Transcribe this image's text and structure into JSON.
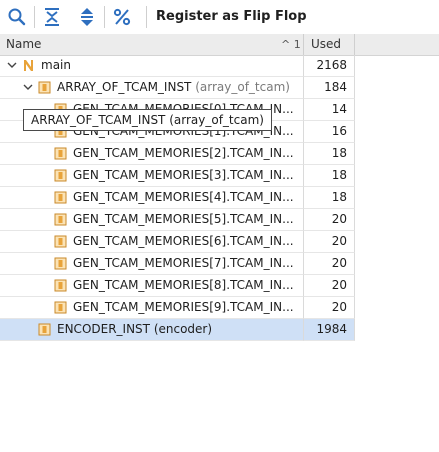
{
  "toolbar": {
    "title": "Register as Flip Flop",
    "buttons": [
      {
        "icon": "search-icon"
      },
      {
        "icon": "collapse-all-icon"
      },
      {
        "icon": "expand-all-icon"
      },
      {
        "icon": "percent-icon"
      }
    ]
  },
  "table": {
    "columns": {
      "name": "Name",
      "used": "Used",
      "sort_indicator": "^ 1"
    },
    "rows": [
      {
        "label": "main",
        "sub": "",
        "used": "2168"
      },
      {
        "label": "ARRAY_OF_TCAM_INST",
        "sub": "(array_of_tcam)",
        "used": "184"
      },
      {
        "label": "GEN_TCAM_MEMORIES[0].TCAM_IN...",
        "sub": "",
        "used": "14"
      },
      {
        "label": "GEN_TCAM_MEMORIES[1].TCAM_IN...",
        "sub": "",
        "used": "16"
      },
      {
        "label": "GEN_TCAM_MEMORIES[2].TCAM_IN...",
        "sub": "",
        "used": "18"
      },
      {
        "label": "GEN_TCAM_MEMORIES[3].TCAM_IN...",
        "sub": "",
        "used": "18"
      },
      {
        "label": "GEN_TCAM_MEMORIES[4].TCAM_IN...",
        "sub": "",
        "used": "18"
      },
      {
        "label": "GEN_TCAM_MEMORIES[5].TCAM_IN...",
        "sub": "",
        "used": "20"
      },
      {
        "label": "GEN_TCAM_MEMORIES[6].TCAM_IN...",
        "sub": "",
        "used": "20"
      },
      {
        "label": "GEN_TCAM_MEMORIES[7].TCAM_IN...",
        "sub": "",
        "used": "20"
      },
      {
        "label": "GEN_TCAM_MEMORIES[8].TCAM_IN...",
        "sub": "",
        "used": "20"
      },
      {
        "label": "GEN_TCAM_MEMORIES[9].TCAM_IN...",
        "sub": "",
        "used": "20"
      },
      {
        "label": "ENCODER_INST (encoder)",
        "sub": "",
        "used": "1984"
      }
    ]
  },
  "tooltip": {
    "text": "ARRAY_OF_TCAM_INST (array_of_tcam)"
  },
  "colors": {
    "accent": "#2e6fbf",
    "selected_row": "#cfe0f6",
    "instance_icon": "#e8a33a",
    "top_icon": "#e8a33a"
  }
}
